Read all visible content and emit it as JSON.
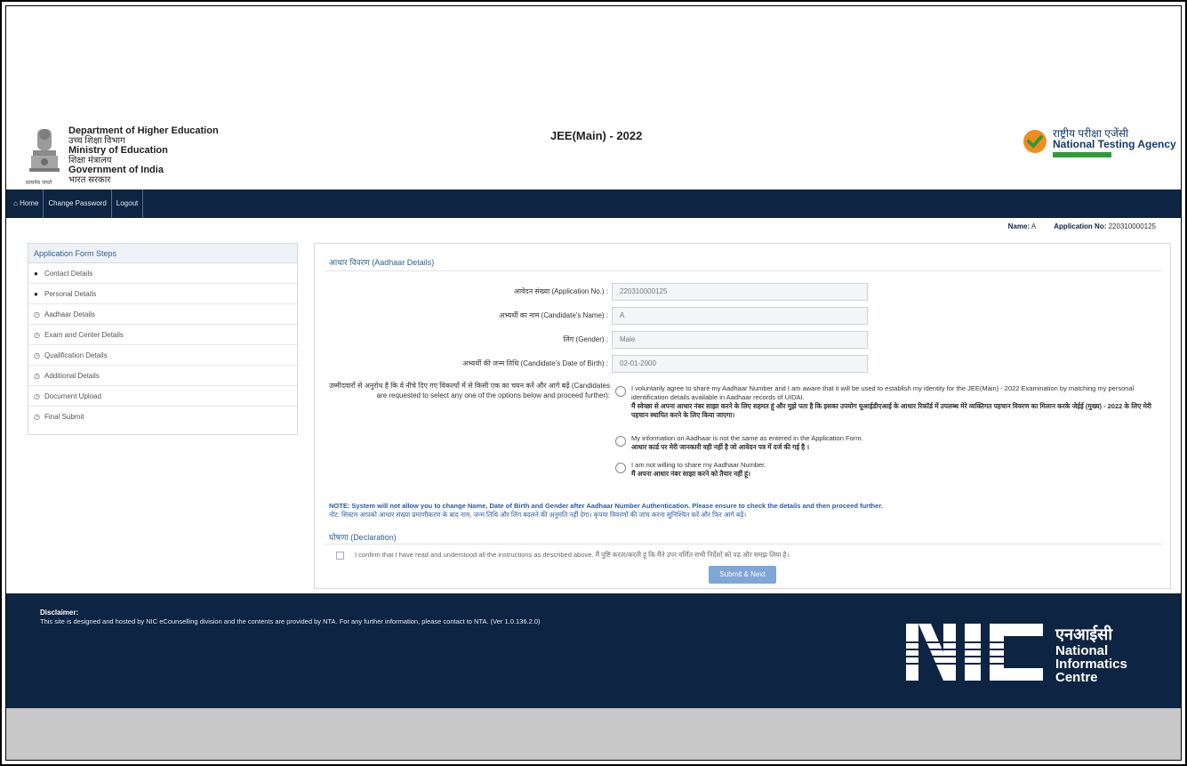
{
  "header": {
    "dept_lines": [
      "Department of Higher Education",
      "उच्च शिक्षा विभाग",
      "Ministry of Education",
      "शिक्षा मंत्रालय",
      "Government of India",
      "भारत सरकार"
    ],
    "emblem_caption": "सत्यमेव जयते",
    "exam_title": "JEE(Main) - 2022",
    "nta_hindi": "राष्ट्रीय परीक्षा एजेंसी",
    "nta_english": "National Testing Agency"
  },
  "nav": {
    "home": "Home",
    "change_password": "Change Password",
    "logout": "Logout"
  },
  "user": {
    "name_label": "Name:",
    "name_value": "A",
    "app_label": "Application No:",
    "app_value": "220310000125"
  },
  "sidebar": {
    "title": "Application Form Steps",
    "steps": [
      {
        "label": "Contact Details",
        "done": true
      },
      {
        "label": "Personal Details",
        "done": true
      },
      {
        "label": "Aadhaar Details",
        "done": false
      },
      {
        "label": "Exam and Center Details",
        "done": false
      },
      {
        "label": "Qualification Details",
        "done": false
      },
      {
        "label": "Additional Details",
        "done": false
      },
      {
        "label": "Document Upload",
        "done": false
      },
      {
        "label": "Final Submit",
        "done": false
      }
    ]
  },
  "main": {
    "section_title": "आधार विवरण (Aadhaar Details)",
    "fields": [
      {
        "label": "आवेदन संख्या (Application No.) :",
        "value": "220310000125"
      },
      {
        "label": "अभ्यर्थी का नाम (Candidate's Name) :",
        "value": "A"
      },
      {
        "label": "लिंग (Gender) :",
        "value": "Male"
      },
      {
        "label": "अभ्यर्थी की जन्म तिथि (Candidate's Date of Birth) :",
        "value": "02-01-2000"
      }
    ],
    "consent_label": "उम्मीदवारों से अनुरोध है कि वे नीचे दिए गए विकल्पों में से किसी एक का चयन करें और आगे बढ़ें (Candidates are requested to select any one of the options below and proceed further):",
    "options": [
      {
        "en": "I voluntarily agree to share my Aadhaar Number and I am aware that it will be used to establish my identity for the JEE(Main) - 2022 Examination by matching my personal identification details available in Aadhaar records of UIDAI.",
        "hi": "मैं स्वेच्छा से अपना आधार नंबर साझा करने के लिए सहमत हूं और मुझे पता है कि इसका उपयोग यूआईडीएआई के आधार रिकॉर्ड में उपलब्ध मेरे व्यक्तिगत पहचान विवरण का मिलान करके जेईई (मुख्य) - 2022 के लिए मेरी पहचान स्थापित करने के लिए किया जाएगा।"
      },
      {
        "en": "My information on Aadhaar is not the same as entered in the Application Form.",
        "hi": "आधार कार्ड पर मेरी जानकारी वही नहीं है जो आवेदन पत्र में दर्ज की गई है ।"
      },
      {
        "en": "I am not willing to share my Aadhaar Number.",
        "hi": "मैं अपना आधार नंबर साझा करने को तैयार नहीं हूं।"
      }
    ],
    "note_en": "NOTE: System will not allow you to change Name, Date of Birth and Gender after Aadhaar Number Authentication. Please ensure to check the details and then proceed further.",
    "note_hi": "नोट: सिस्टम आपको आधार संख्या प्रमाणीकरण के बाद नाम, जन्म तिथि और लिंग बदलने की अनुमति नहीं देगा। कृपया विवरणों की जांच करना सुनिश्चित करें और फिर आगे बढ़ें।",
    "declaration_title": "घोषणा (Declaration)",
    "declaration_text": "I confirm that I have read and understood all the instructions as described above. मैं पुष्टि करता/करती हूं कि मैंने उपर वर्णित सभी निर्देशों को पढ़ और समझ लिया है।",
    "submit_label": "Submit & Next"
  },
  "footer": {
    "disclaimer_title": "Disclaimer:",
    "disclaimer_text": "This site is designed and hosted by NIC eCounselling division and the contents are provided by NTA. For any further information, please contact to NTA. (Ver 1.0.136.2.0)",
    "nic_hindi": "एनआईसी",
    "nic_lines": [
      "National",
      "Informatics",
      "Centre"
    ]
  },
  "colors": {
    "navbar": "#0d2442",
    "accent": "#2f5f95",
    "submit": "#7fa6d6",
    "note": "#2b5aa0",
    "nta_check": "#f28c1e",
    "nta_green": "#2e9b3a"
  }
}
